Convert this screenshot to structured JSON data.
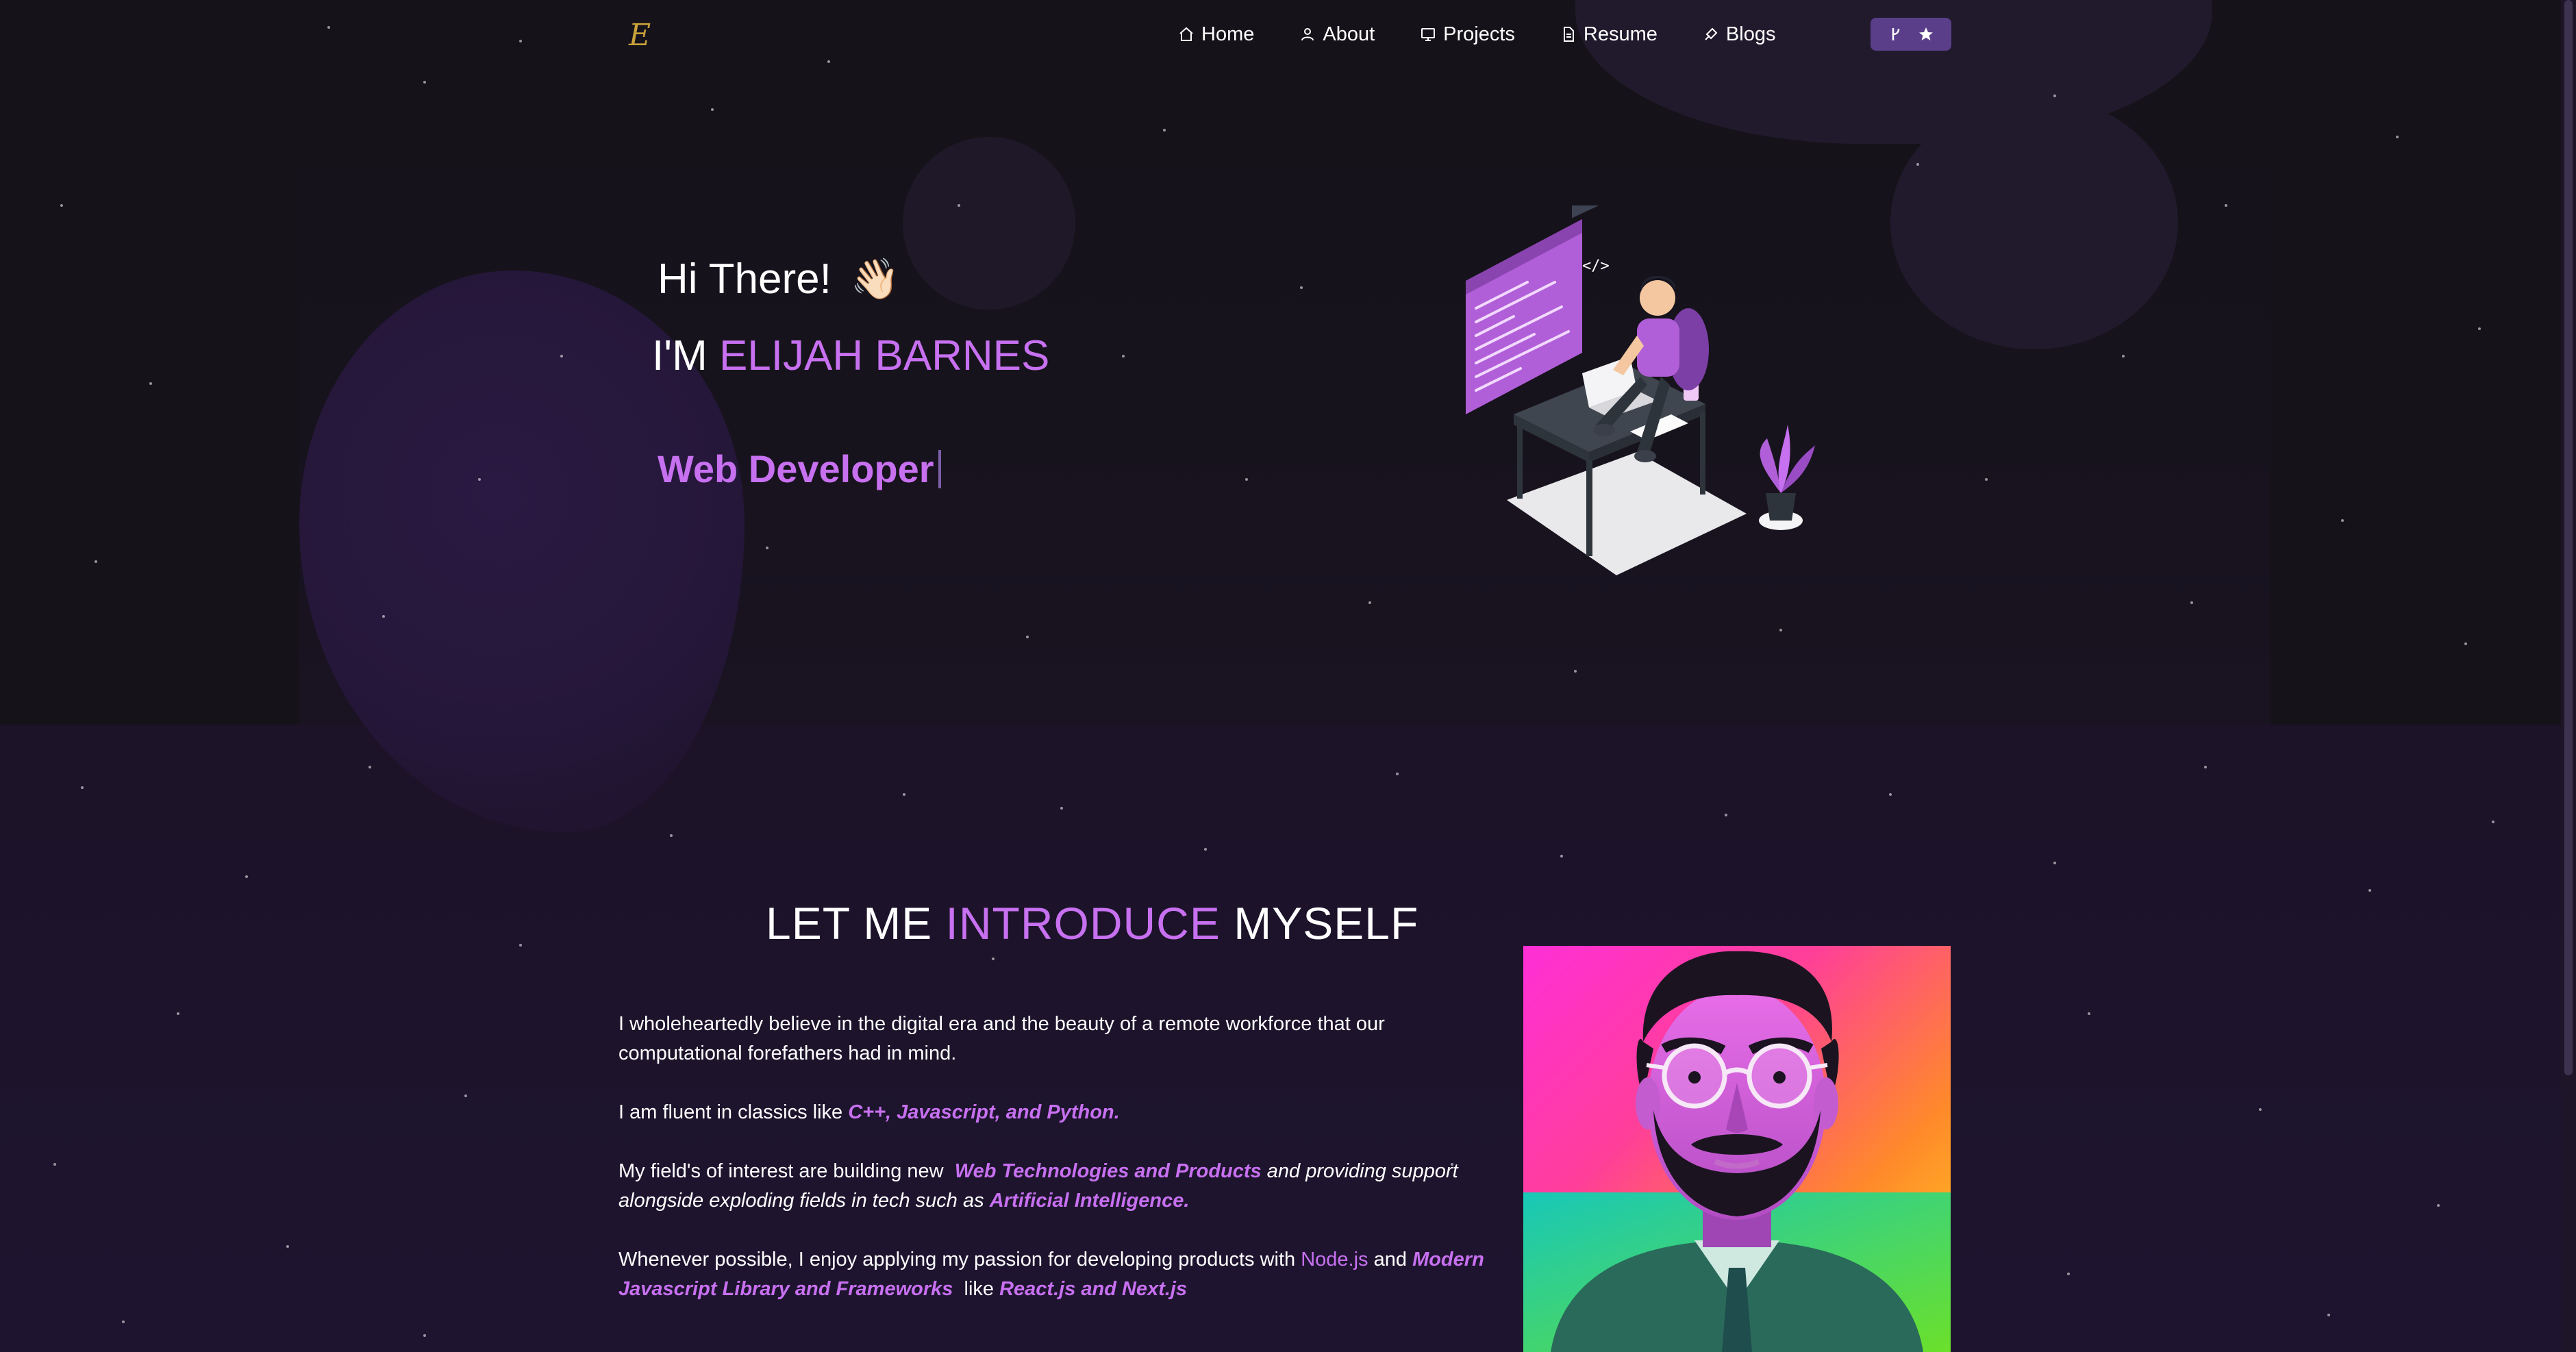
{
  "nav": {
    "logo": "E",
    "items": [
      {
        "label": "Home",
        "icon": "home-icon"
      },
      {
        "label": "About",
        "icon": "user-icon"
      },
      {
        "label": "Projects",
        "icon": "projects-icon"
      },
      {
        "label": "Resume",
        "icon": "document-icon"
      },
      {
        "label": "Blogs",
        "icon": "blog-icon"
      }
    ],
    "github_star_icons": [
      "fork-icon",
      "star-icon"
    ]
  },
  "hero": {
    "greeting": "Hi There!",
    "wave_emoji": "👋🏻",
    "im_prefix": "I'M",
    "name": "ELIJAH BARNES",
    "typed_role": "Web Developer"
  },
  "intro": {
    "title_part1": "LET ME",
    "title_accent": "INTRODUCE",
    "title_part3": "MYSELF",
    "p1": "I wholeheartedly believe in the digital era and the beauty of a remote workforce that our computational forefathers had in mind.",
    "p2_prefix": "I am fluent in classics like",
    "p2_highlight": "C++, Javascript, and Python.",
    "p3_prefix": "My field's of interest are building new",
    "p3_highlight1": "Web Technologies and Products",
    "p3_middle": "and providing support alongside exploding fields in tech such as",
    "p3_highlight2": "Artificial Intelligence.",
    "p4_prefix": "Whenever possible, I enjoy applying my passion for developing products with",
    "p4_highlight1": "Node.js",
    "p4_middle": "and",
    "p4_highlight2": "Modern Javascript Library and Frameworks",
    "p4_like": "like",
    "p4_highlight3": "React.js and Next.js"
  },
  "colors": {
    "accent": "#c770f0",
    "background": "#1b1327",
    "logo": "#c9a13b",
    "button": "#5a3e8a"
  }
}
